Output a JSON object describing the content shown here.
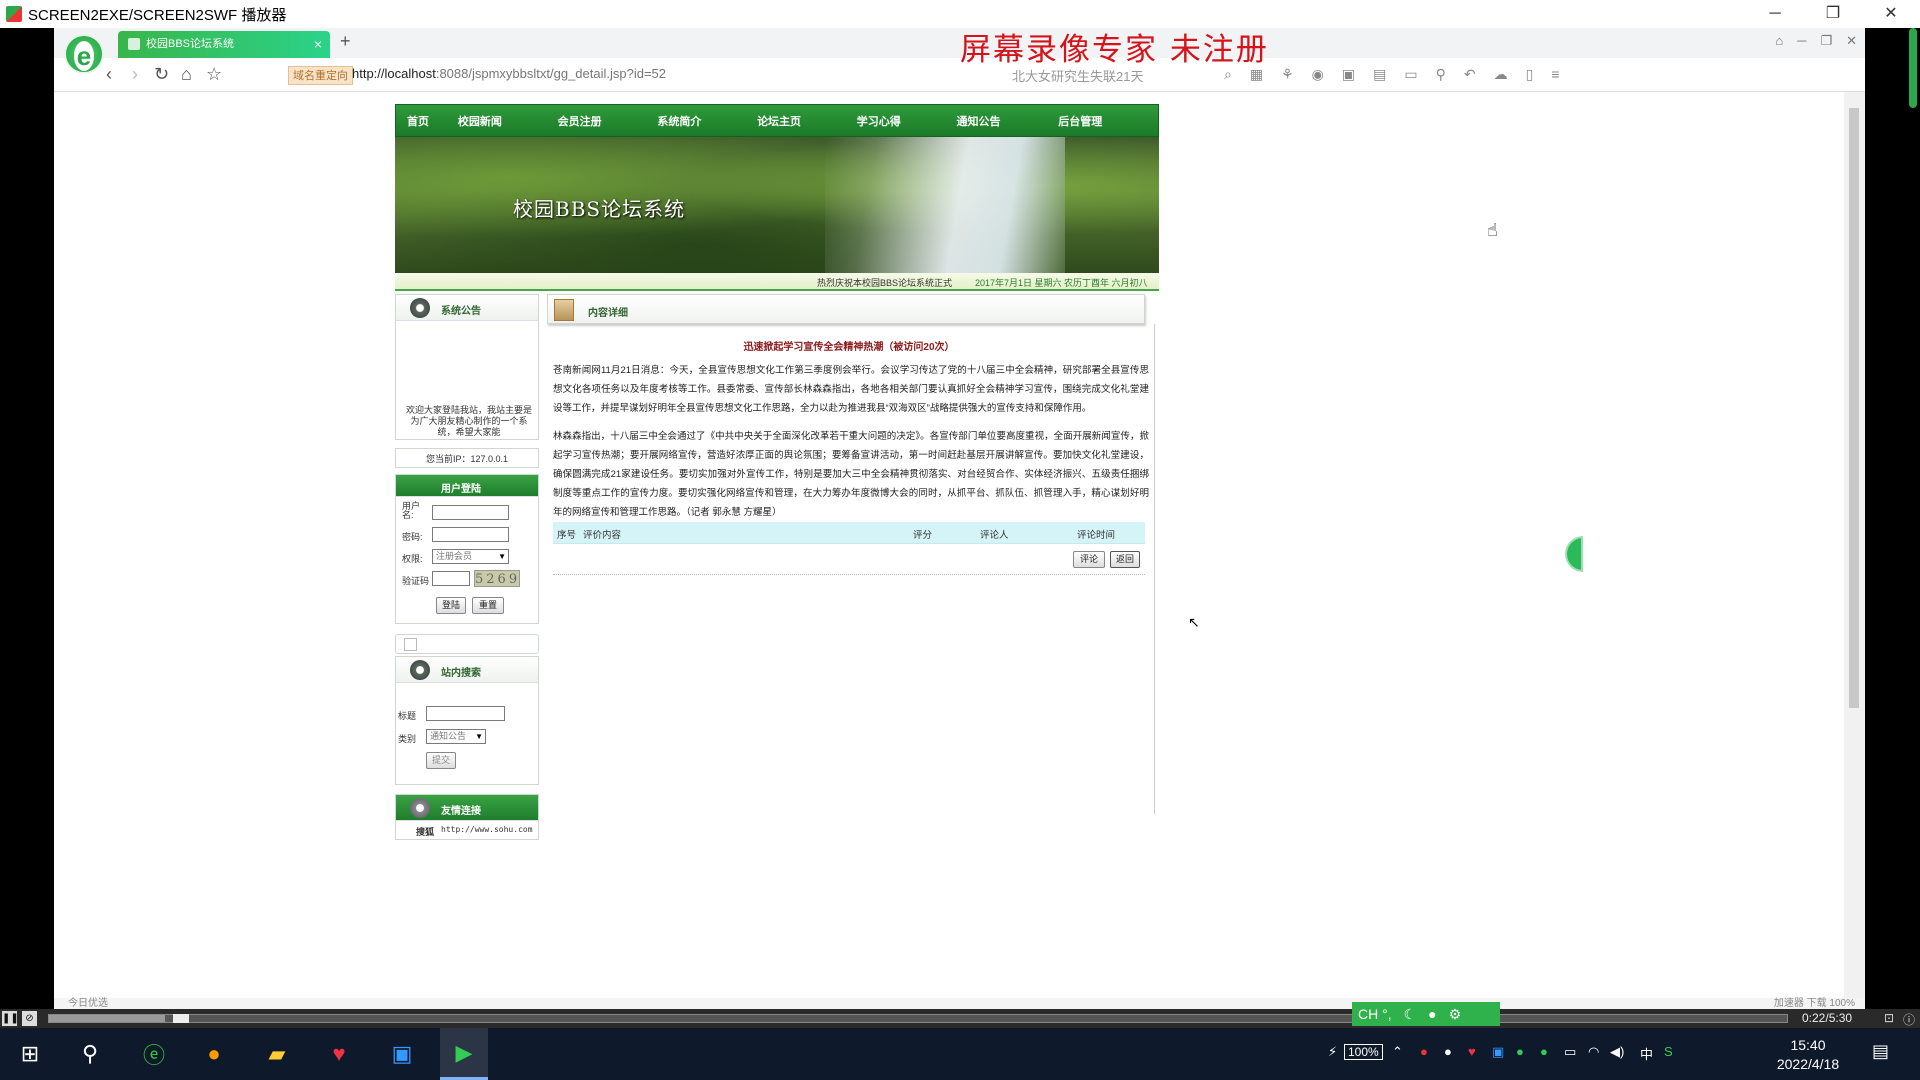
{
  "player": {
    "title": "SCREEN2EXE/SCREEN2SWF 播放器",
    "win_buttons": [
      "─",
      "❐",
      "✕"
    ]
  },
  "browser": {
    "tab_title": "校园BBS论坛系统",
    "tab_close": "×",
    "new_tab": "+",
    "watermark": "屏幕录像专家  未注册",
    "redirect_badge": "域名重定向",
    "url_host": "http://localhost",
    "url_rest": ":8088/jspmxybbsltxt/gg_detail.jsp?id=52",
    "search_hint": "北大女研究生失联21天",
    "status_left": "今日优选",
    "status_right": "加速器   下载                    100%"
  },
  "site": {
    "nav": [
      "首页",
      "校园新闻",
      "会员注册",
      "系统简介",
      "论坛主页",
      "学习心得",
      "通知公告",
      "后台管理"
    ],
    "banner_title": "校园BBS论坛系统",
    "ticker_text": "热烈庆祝本校园BBS论坛系统正式",
    "ticker_date": "2017年7月1日  星期六  农历丁酉年  六月初八"
  },
  "sidebar": {
    "notice_title": "系统公告",
    "notice_text": "欢迎大家登陆我站，我站主要是为广大朋友精心制作的一个系统，希望大家能",
    "ip_text": "您当前IP：127.0.0.1",
    "login_title": "用户登陆",
    "username_label": "用户名:",
    "password_label": "密码:",
    "role_label": "权限:",
    "role_value": "注册会员",
    "captcha_label": "验证码",
    "captcha_value": "5269",
    "login_btn": "登陆",
    "reset_btn": "重置",
    "search_title": "站内搜索",
    "title_label": "标题",
    "category_label": "类别",
    "category_value": "通知公告",
    "submit_btn": "提交",
    "links_title": "友情连接",
    "link1_name": "搜狐",
    "link1_url": "http://www.sohu.com"
  },
  "content": {
    "head_title": "内容详细",
    "article_title": "迅速掀起学习宣传全会精神热潮（被访问20次）",
    "para1": "苍南新闻网11月21日消息：今天，全县宣传思想文化工作第三季度例会举行。会议学习传达了党的十八届三中全会精神，研究部署全县宣传思想文化各项任务以及年度考核等工作。县委常委、宣传部长林森森指出，各地各相关部门要认真抓好全会精神学习宣传，围绕完成文化礼堂建设等工作，并提早谋划好明年全县宣传思想文化工作思路，全力以赴为推进我县“双海双区”战略提供强大的宣传支持和保障作用。",
    "para2": "林森森指出，十八届三中全会通过了《中共中央关于全面深化改革若干重大问题的决定》。各宣传部门单位要高度重视，全面开展新闻宣传，掀起学习宣传热潮；要开展网络宣传，营造好浓厚正面的舆论氛围；要筹备宣讲活动，第一时间赶赴基层开展讲解宣传。要加快文化礼堂建设，确保圆满完成21家建设任务。要切实加强对外宣传工作，特别是要加大三中全会精神贯彻落实、对台经贸合作、实体经济振兴、五级责任捆绑制度等重点工作的宣传力度。要切实强化网络宣传和管理，在大力筹办年度微博大会的同时，从抓平台、抓队伍、抓管理入手，精心谋划好明年的网络宣传和管理工作思路。（记者 郭永慧 方耀星）",
    "cols": [
      "序号",
      "评价内容",
      "评分",
      "评论人",
      "评论时间"
    ],
    "comment_btn": "评论",
    "back_btn": "返回"
  },
  "playback": {
    "time": "0:22/5:30",
    "ime": "CH °,"
  },
  "taskbar": {
    "battery": "100%",
    "ime_lang": "中",
    "time": "15:40",
    "date": "2022/4/18"
  }
}
